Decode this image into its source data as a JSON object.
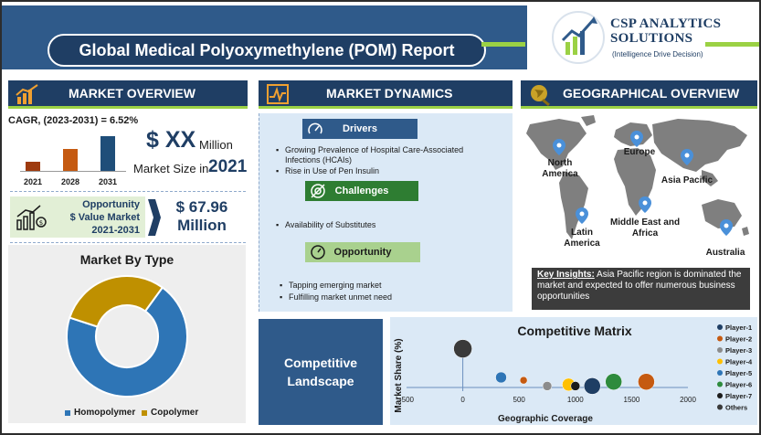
{
  "header": {
    "title": "Global Medical Polyoxymethylene (POM) Report",
    "logo_name_line1": "CSP ANALYTICS",
    "logo_name_line2": "SOLUTIONS",
    "logo_tagline": "(Intelligence Drive Decision)"
  },
  "colors": {
    "navy": "#1f3e64",
    "blue": "#2f5a8a",
    "green": "#9bd144",
    "orange": "#c55a11",
    "homopolymer": "#2e75b6",
    "copolymer": "#bf9000"
  },
  "market_overview": {
    "heading": "MARKET OVERVIEW",
    "icon": "growth-chart-icon",
    "cagr": "CAGR, (2023-2031) = 6.52%",
    "market_size_value": "$ XX",
    "market_size_unit": "Million",
    "market_size_label": "Market Size in",
    "market_size_year": "2021",
    "opportunity_line1": "Opportunity",
    "opportunity_line2": "$ Value Market",
    "opportunity_line3": "2021-2031",
    "opportunity_value_line1": "$ 67.96",
    "opportunity_value_line2": "Million",
    "opportunity_icon": "money-growth-icon"
  },
  "market_dynamics": {
    "heading": "MARKET DYNAMICS",
    "icon": "pulse-chart-icon",
    "drivers": {
      "label": "Drivers",
      "icon": "gauge-icon",
      "items": [
        "Growing Prevalence of Hospital Care-Associated",
        "Infections (HCAIs)",
        "Rise in Use of Pen Insulin"
      ]
    },
    "challenges": {
      "label": "Challenges",
      "icon": "target-icon",
      "items": [
        "Availability of Substitutes"
      ]
    },
    "opportunity": {
      "label": "Opportunity",
      "icon": "gauge-icon",
      "items": [
        "Tapping emerging market",
        "Fulfilling market unmet need"
      ]
    }
  },
  "geographical_overview": {
    "heading": "GEOGRAPHICAL OVERVIEW",
    "icon": "globe-icon",
    "regions": {
      "north_america_1": "North",
      "north_america_2": "America",
      "europe": "Europe",
      "asia_pacific": "Asia Pacific",
      "latin_america_1": "Latin",
      "latin_america_2": "America",
      "mea_1": "Middle East and",
      "mea_2": "Africa",
      "australia": "Australia"
    },
    "insight_label": "Key Insights:",
    "insight_text": "Asia Pacific region is dominated the market and expected to offer numerous business opportunities"
  },
  "competitive_landscape": {
    "line1": "Competitive",
    "line2": "Landscape"
  },
  "chart_data": [
    {
      "type": "bar",
      "categories": [
        "2021",
        "2028",
        "2031"
      ],
      "values": [
        1,
        2.4,
        3.8
      ],
      "colors": [
        "#9e3a0e",
        "#c55a11",
        "#1f4e79"
      ],
      "title": "",
      "xlabel": "",
      "ylabel": "",
      "grid": false
    },
    {
      "type": "pie",
      "title": "Market By Type",
      "donut": true,
      "labels": [
        "Homopolymer",
        "Copolymer"
      ],
      "values": [
        70,
        30
      ],
      "colors": [
        "#2e75b6",
        "#bf9000"
      ],
      "legend": "bottom"
    },
    {
      "type": "scatter",
      "title": "Competitive Matrix",
      "xlabel": "Geographic Coverage",
      "ylabel": "Market Share (%)",
      "xlim": [
        -500,
        2000
      ],
      "xticks": [
        "-500",
        "0",
        "500",
        "1000",
        "1500",
        "2000"
      ],
      "grid": false,
      "legend": "right",
      "series": [
        {
          "name": "Player-1",
          "x": 1150,
          "y": 0.1,
          "size": 9,
          "color": "#1f3e64"
        },
        {
          "name": "Player-2",
          "x": 1630,
          "y": 0.4,
          "size": 9,
          "color": "#c55a11"
        },
        {
          "name": "Player-3",
          "x": 750,
          "y": 0.1,
          "size": 5,
          "color": "#8c8c8c"
        },
        {
          "name": "Player-4",
          "x": 940,
          "y": 0.2,
          "size": 7,
          "color": "#ffc000"
        },
        {
          "name": "Player-5",
          "x": 340,
          "y": 0.7,
          "size": 6,
          "color": "#2e75b6"
        },
        {
          "name": "Player-6",
          "x": 1340,
          "y": 0.4,
          "size": 9,
          "color": "#2e8b3d"
        },
        {
          "name": "Player-7",
          "x": 1000,
          "y": 0.1,
          "size": 5,
          "color": "#1b1b1b"
        },
        {
          "name": "Others",
          "x": 0,
          "y": 2.7,
          "size": 10,
          "color": "#3a3a3a"
        },
        {
          "name": "",
          "x": 540,
          "y": 0.5,
          "size": 4,
          "color": "#c55a11"
        }
      ],
      "ylim": [
        -0.5,
        3.5
      ]
    }
  ]
}
